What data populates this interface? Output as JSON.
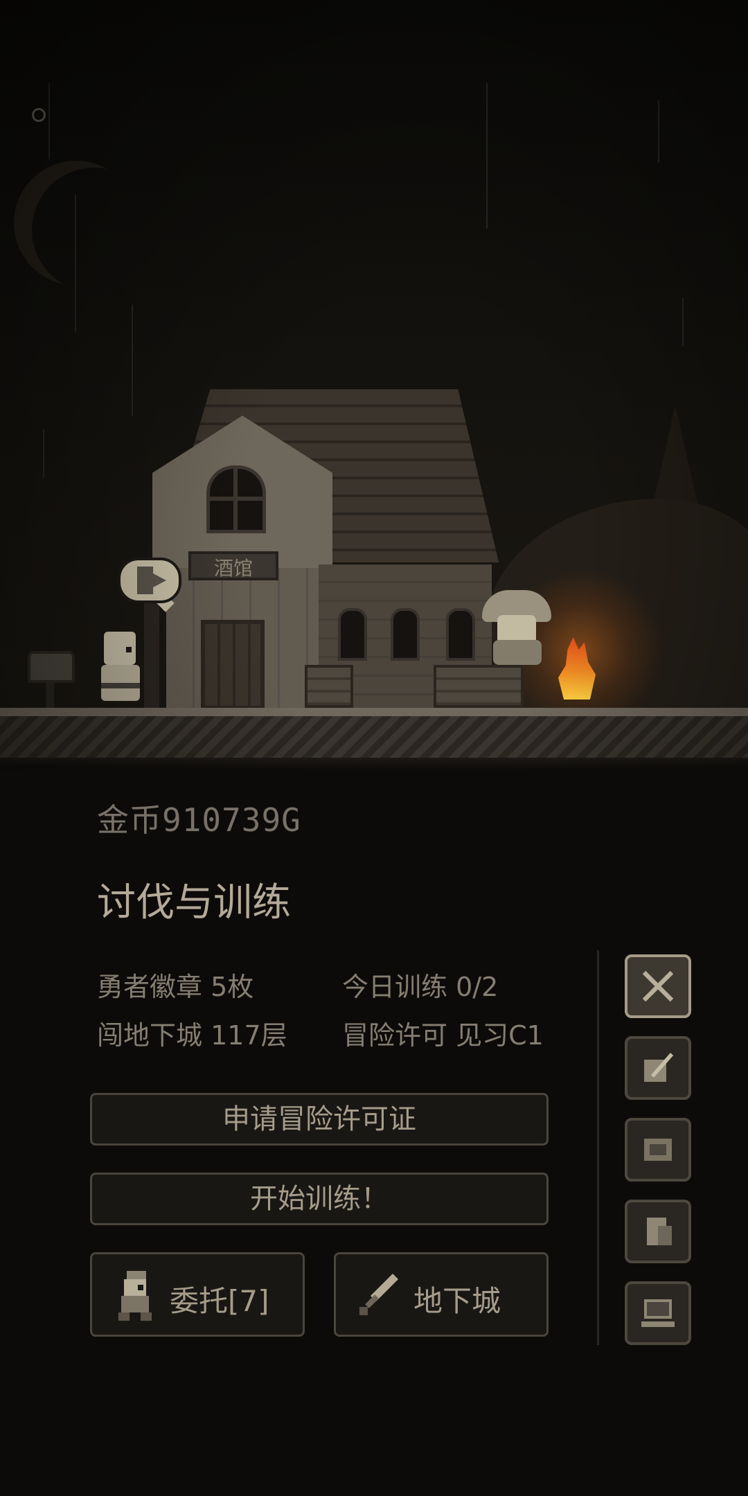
{
  "scene": {
    "tavern_sign": "酒馆"
  },
  "status": {
    "gold_label": "金币",
    "gold_value": "910739G"
  },
  "section": {
    "title": "讨伐与训练"
  },
  "stats": {
    "badge_label": "勇者徽章",
    "badge_value": "5枚",
    "training_label": "今日训练",
    "training_value": "0/2",
    "dungeon_label": "闯地下城",
    "dungeon_value": "117层",
    "license_label": "冒险许可",
    "license_value": "见习C1"
  },
  "buttons": {
    "apply_license": "申请冒险许可证",
    "start_training": "开始训练！",
    "commission": "委托[7]",
    "dungeon": "地下城"
  },
  "side_icons": [
    "crossed-swords-icon",
    "quill-note-icon",
    "scroll-map-icon",
    "document-icon",
    "computer-icon"
  ]
}
